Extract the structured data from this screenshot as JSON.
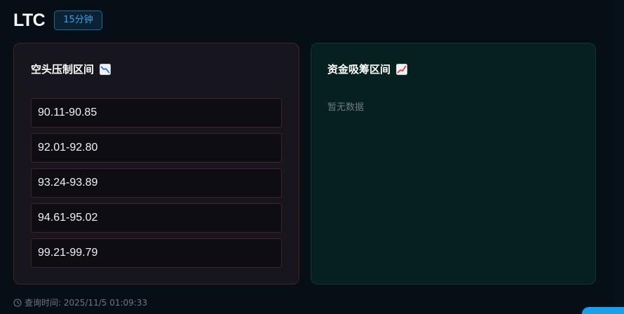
{
  "header": {
    "symbol": "LTC",
    "timeframe": "15分钟"
  },
  "short_panel": {
    "title": "空头压制区间",
    "icon": "chart-decreasing-icon",
    "zones": [
      "90.11-90.85",
      "92.01-92.80",
      "93.24-93.89",
      "94.61-95.02",
      "99.21-99.79"
    ]
  },
  "long_panel": {
    "title": "资金吸筹区间",
    "icon": "chart-increasing-icon",
    "empty_text": "暂无数据"
  },
  "footer": {
    "query_time": "查询时间: 2025/11/5 01:09:33"
  },
  "colors": {
    "background": "#060e16",
    "badge": "#39a2e6",
    "short_border": "#4a1e26",
    "long_bg": "#05201e"
  }
}
